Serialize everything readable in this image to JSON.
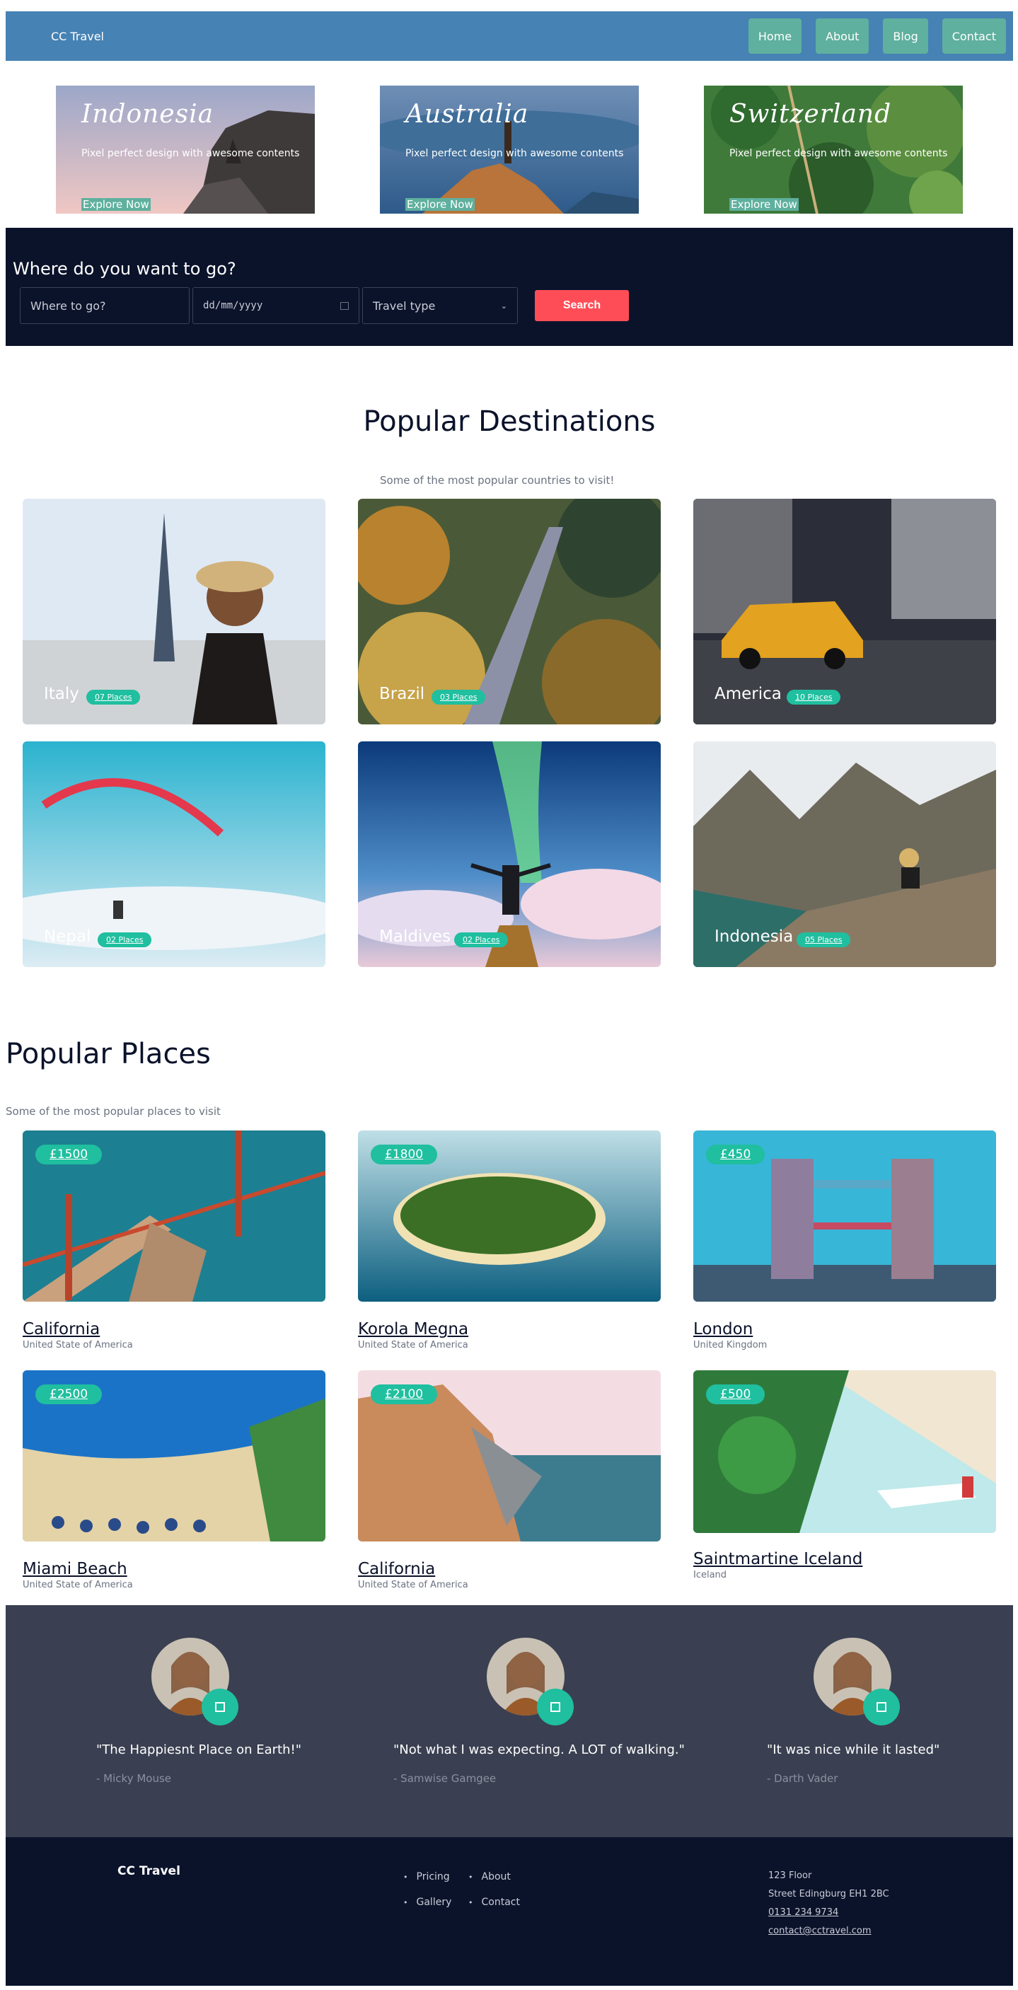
{
  "nav": {
    "brand": "CC Travel",
    "links": [
      "Home",
      "About",
      "Blog",
      "Contact"
    ]
  },
  "hero": [
    {
      "title": "Indonesia",
      "desc": "Pixel perfect design with awesome contents",
      "cta": "Explore Now"
    },
    {
      "title": "Australia",
      "desc": "Pixel perfect design with awesome contents",
      "cta": "Explore Now"
    },
    {
      "title": "Switzerland",
      "desc": "Pixel perfect design with awesome contents",
      "cta": "Explore Now"
    }
  ],
  "search": {
    "heading": "Where do you want to go?",
    "where_placeholder": "Where to go?",
    "date_placeholder": "dd/mm/yyyy",
    "type_selected": "Travel type",
    "button": "Search"
  },
  "destinations": {
    "title": "Popular Destinations",
    "subtitle": "Some of the most popular countries to visit!",
    "items": [
      {
        "name": "Italy",
        "places": "07 Places"
      },
      {
        "name": "Brazil",
        "places": "03 Places"
      },
      {
        "name": "America",
        "places": "10 Places"
      },
      {
        "name": "Nepal",
        "places": "02 Places"
      },
      {
        "name": "Maldives",
        "places": "02 Places"
      },
      {
        "name": "Indonesia",
        "places": "05 Places"
      }
    ]
  },
  "places": {
    "title": "Popular Places",
    "subtitle": "Some of the most popular places to visit",
    "items": [
      {
        "price": "£1500",
        "name": "California",
        "country": "United State of America"
      },
      {
        "price": "£1800",
        "name": "Korola Megna",
        "country": "United State of America"
      },
      {
        "price": "£450",
        "name": "London",
        "country": "United Kingdom"
      },
      {
        "price": "£2500",
        "name": "Miami Beach",
        "country": "United State of America"
      },
      {
        "price": "£2100",
        "name": "California",
        "country": "United State of America"
      },
      {
        "price": "£500",
        "name": "Saintmartine Iceland",
        "country": "Iceland"
      }
    ]
  },
  "testimonials": [
    {
      "quote": "\"The Happiesnt Place on Earth!\"",
      "author": "- Micky Mouse"
    },
    {
      "quote": "\"Not what I was expecting. A LOT of walking.\"",
      "author": "- Samwise Gamgee"
    },
    {
      "quote": "\"It was nice while it lasted\"",
      "author": "- Darth Vader"
    }
  ],
  "footer": {
    "brand": "CC Travel",
    "links": [
      "Pricing",
      "About",
      "Gallery",
      "Contact"
    ],
    "address1": "123 Floor",
    "address2": "Street Edingburg EH1 2BC",
    "phone": "0131 234 9734",
    "email": "contact@cctravel.com"
  },
  "colors": {
    "nav_bg": "#4682b4",
    "nav_button": "#5fb09e",
    "dark_navy": "#0b132b",
    "accent_red": "#ff4d57",
    "accent_teal": "#1fbf9f",
    "testimonial_bg": "#3a4051"
  }
}
